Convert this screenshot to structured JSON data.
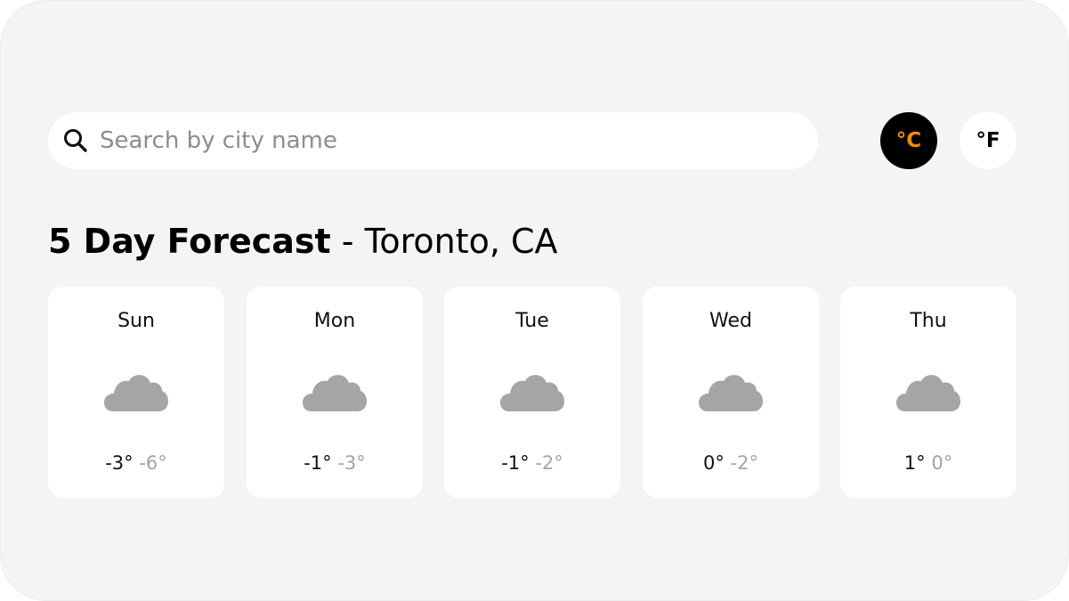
{
  "search": {
    "placeholder": "Search by city name",
    "value": ""
  },
  "units": {
    "celsius_label": "°C",
    "fahrenheit_label": "°F",
    "active": "celsius",
    "active_color": "#000000",
    "active_text_color": "#f28c00"
  },
  "heading": {
    "title": "5 Day Forecast",
    "separator": " - ",
    "location": "Toronto, CA"
  },
  "forecast": [
    {
      "day": "Sun",
      "icon": "cloud-icon",
      "high": "-3°",
      "low": "-6°"
    },
    {
      "day": "Mon",
      "icon": "cloud-icon",
      "high": "-1°",
      "low": "-3°"
    },
    {
      "day": "Tue",
      "icon": "cloud-icon",
      "high": "-1°",
      "low": "-2°"
    },
    {
      "day": "Wed",
      "icon": "cloud-icon",
      "high": "0°",
      "low": "-2°"
    },
    {
      "day": "Thu",
      "icon": "cloud-icon",
      "high": "1°",
      "low": "0°"
    }
  ],
  "colors": {
    "background": "#f4f4f6",
    "card": "#ffffff",
    "cloud": "#a5a5a5",
    "low_temp": "#a4a4a4"
  }
}
